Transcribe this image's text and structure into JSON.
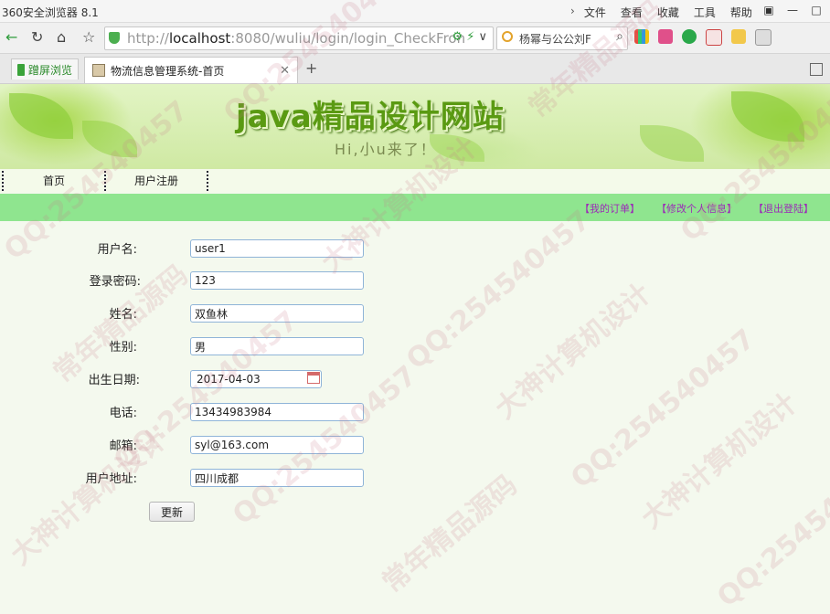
{
  "browser": {
    "app_title": "360安全浏览器 8.1",
    "menu": [
      "文件",
      "查看",
      "收藏",
      "工具",
      "帮助"
    ],
    "url_prefix": "http://",
    "url_host": "localhost",
    "url_rest": ":8080/wuliu/login/login_CheckFron",
    "search_value": "杨幂与公公刘F",
    "tab_left_label": "蹭屏浏览",
    "tab_title": "物流信息管理系统-首页"
  },
  "banner": {
    "title": "java精品设计网站",
    "subtitle": "Hi,小u来了！"
  },
  "nav": {
    "items": [
      "首页",
      "用户注册"
    ]
  },
  "user_links": {
    "orders": "【我的订单】",
    "edit_profile": "【修改个人信息】",
    "logout": "【退出登陆】"
  },
  "form": {
    "username_label": "用户名:",
    "username_value": "user1",
    "password_label": "登录密码:",
    "password_value": "123",
    "name_label": "姓名:",
    "name_value": "双鱼林",
    "gender_label": "性别:",
    "gender_value": "男",
    "birth_label": "出生日期:",
    "birth_value": "2017-04-03",
    "phone_label": "电话:",
    "phone_value": "13434983984",
    "email_label": "邮箱:",
    "email_value": "syl@163.com",
    "address_label": "用户地址:",
    "address_value": "四川成都",
    "update_label": "更新"
  },
  "watermark": {
    "qq": "QQ:254540457",
    "brand1": "大神计算机设计",
    "brand2": "常年精品源码"
  }
}
